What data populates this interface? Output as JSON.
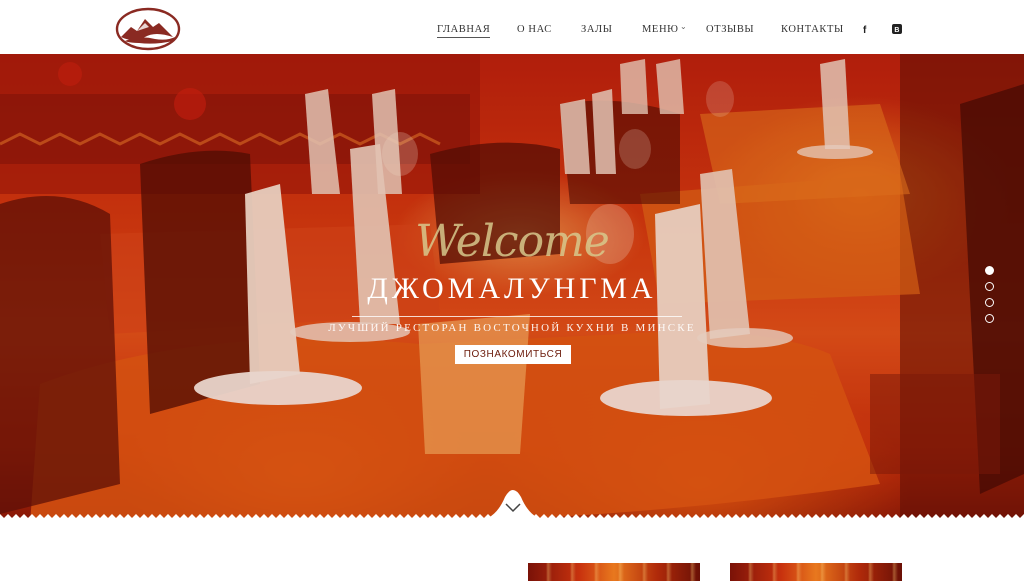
{
  "header": {
    "nav": [
      {
        "label": "ГЛАВНАЯ",
        "active": true
      },
      {
        "label": "О НАС",
        "active": false
      },
      {
        "label": "ЗАЛЫ",
        "active": false
      },
      {
        "label": "МЕНЮ",
        "active": false,
        "has_dropdown": true
      },
      {
        "label": "ОТЗЫВЫ",
        "active": false
      },
      {
        "label": "КОНТАКТЫ",
        "active": false
      }
    ],
    "social": [
      {
        "icon": "facebook-icon",
        "glyph": "f"
      },
      {
        "icon": "vk-icon",
        "glyph": "B"
      }
    ]
  },
  "hero": {
    "welcome": "Welcome",
    "title": "ДЖОМАЛУНГМА",
    "subtitle": "ЛУЧШИЙ РЕСТОРАН ВОСТОЧНОЙ КУХНИ В МИНСКЕ",
    "cta_label": "ПОЗНАКОМИТЬСЯ",
    "slides_count": 4,
    "active_slide": 1
  },
  "colors": {
    "logo": "#8a2a22",
    "hero_primary": "#d0380f",
    "cta_text": "#6b1a0a"
  },
  "icons": {
    "logo": "mountain-logo-icon",
    "scroll": "chevron-down-icon",
    "dropdown": "chevron-down-icon"
  }
}
